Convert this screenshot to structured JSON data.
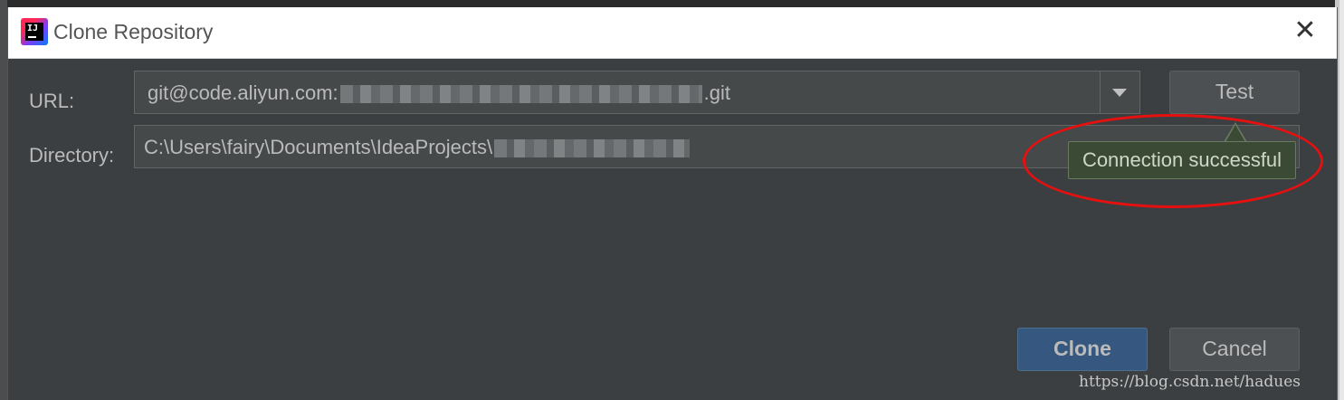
{
  "window": {
    "title": "Clone Repository",
    "close_glyph": "✕"
  },
  "form": {
    "url_label": "URL:",
    "url_value_prefix": "git@code.aliyun.com:",
    "url_value_suffix": ".git",
    "directory_label": "Directory:",
    "directory_value": "C:\\Users\\fairy\\Documents\\IdeaProjects\\"
  },
  "buttons": {
    "test": "Test",
    "clone": "Clone",
    "cancel": "Cancel"
  },
  "tooltip": {
    "text": "Connection successful"
  },
  "watermark": {
    "text": "https://blog.csdn.net/hadues"
  },
  "icons": {
    "app": "intellij-idea-icon",
    "close": "close-icon",
    "dropdown": "chevron-down-icon"
  },
  "colors": {
    "dialog_bg": "#3c3f41",
    "field_bg": "#45494a",
    "primary_button": "#365880",
    "tooltip_bg": "#3b4a35",
    "annotation_red": "#e51010"
  }
}
